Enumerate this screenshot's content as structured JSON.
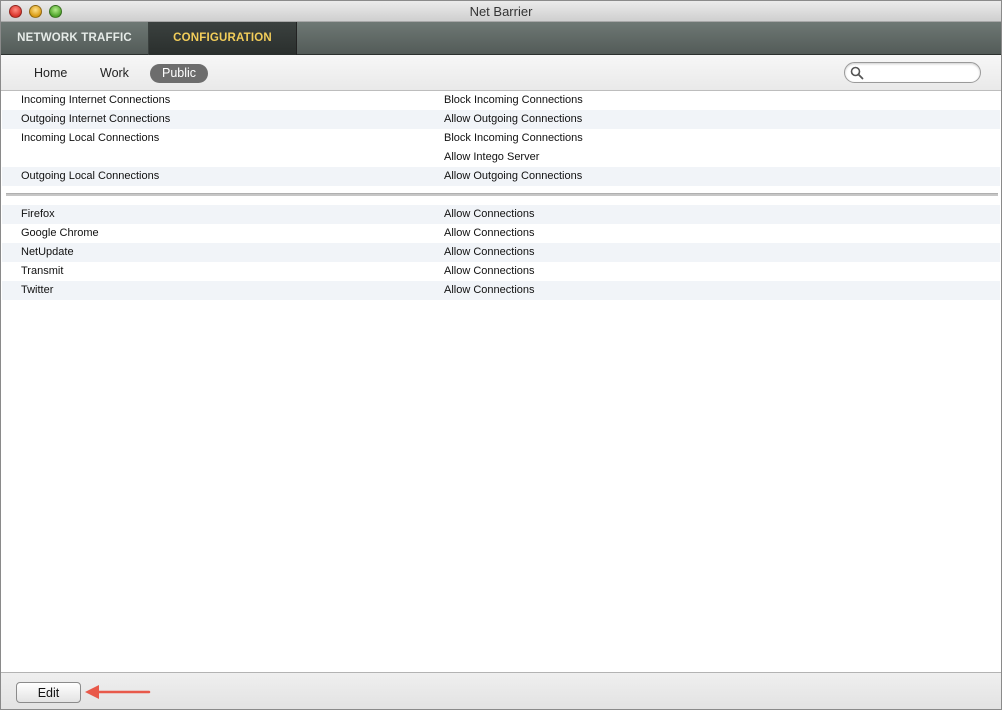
{
  "window": {
    "title": "Net Barrier"
  },
  "tabs": [
    {
      "label": "NETWORK TRAFFIC",
      "active": false
    },
    {
      "label": "CONFIGURATION",
      "active": true
    }
  ],
  "profiles": [
    {
      "label": "Home",
      "selected": false
    },
    {
      "label": "Work",
      "selected": false
    },
    {
      "label": "Public",
      "selected": true
    }
  ],
  "search": {
    "value": "",
    "placeholder": ""
  },
  "connection_rules": [
    {
      "name": "Incoming Internet Connections",
      "action": "Block Incoming Connections"
    },
    {
      "name": "Outgoing Internet Connections",
      "action": "Allow Outgoing Connections"
    },
    {
      "name": "Incoming Local Connections",
      "action": "Block Incoming Connections"
    },
    {
      "name": "",
      "action": "Allow Intego Server"
    },
    {
      "name": "Outgoing Local Connections",
      "action": "Allow Outgoing Connections"
    }
  ],
  "app_rules": [
    {
      "name": "Firefox",
      "action": "Allow Connections"
    },
    {
      "name": "Google Chrome",
      "action": "Allow Connections"
    },
    {
      "name": "NetUpdate",
      "action": "Allow Connections"
    },
    {
      "name": "Transmit",
      "action": "Allow Connections"
    },
    {
      "name": "Twitter",
      "action": "Allow Connections"
    }
  ],
  "footer": {
    "edit_label": "Edit"
  },
  "colors": {
    "active_tab_text": "#f2cd5a",
    "selected_profile_bg": "#6d6d6d",
    "arrow": "#e8594a",
    "row_alt": "#f1f4f8"
  }
}
